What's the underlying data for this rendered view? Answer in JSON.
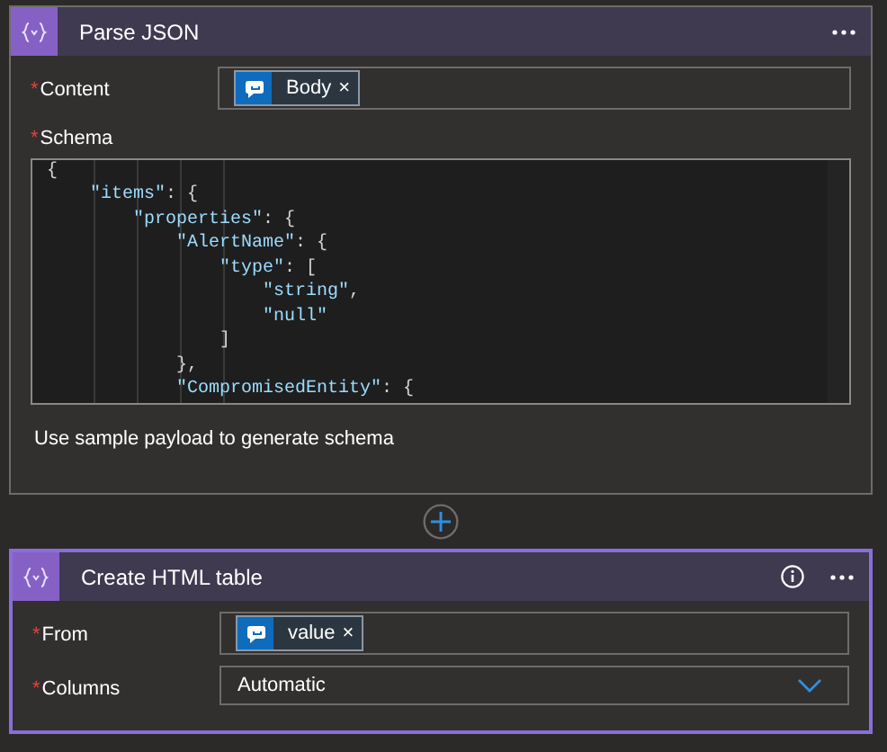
{
  "actions": [
    {
      "title": "Parse JSON",
      "fields": [
        {
          "label": "Content",
          "required_mark": "*",
          "kind": "token",
          "token": "Body",
          "remove": "×"
        },
        {
          "label": "Schema",
          "required_mark": "*",
          "kind": "code",
          "lines": [
            "{",
            "    \"items\": {",
            "        \"properties\": {",
            "            \"AlertName\": {",
            "                \"type\": [",
            "                    \"string\",",
            "                    \"null\"",
            "                ]",
            "            },",
            "            \"CompromisedEntity\": {"
          ]
        }
      ],
      "link": "Use sample payload to generate schema",
      "selected": false
    },
    {
      "title": "Create HTML table",
      "info": true,
      "fields": [
        {
          "label": "From",
          "required_mark": "*",
          "kind": "token",
          "token": "value",
          "remove": "×"
        },
        {
          "label": "Columns",
          "required_mark": "*",
          "kind": "select",
          "value": "Automatic"
        }
      ],
      "selected": true
    }
  ]
}
